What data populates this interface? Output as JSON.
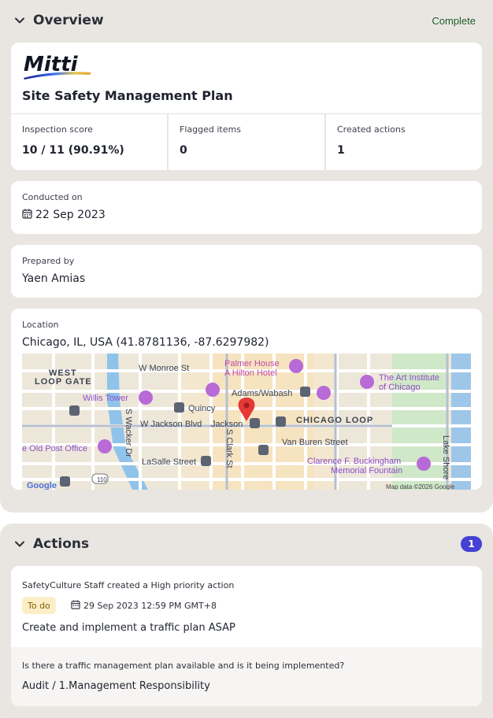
{
  "overview": {
    "title": "Overview",
    "status": "Complete",
    "logo_text": "Mitti",
    "doc_title": "Site Safety Management Plan",
    "stats": [
      {
        "label": "Inspection score",
        "value": "10 / 11 (90.91%)"
      },
      {
        "label": "Flagged items",
        "value": "0"
      },
      {
        "label": "Created actions",
        "value": "1"
      }
    ],
    "conducted": {
      "label": "Conducted on",
      "value": "22 Sep 2023"
    },
    "prepared": {
      "label": "Prepared by",
      "value": "Yaen Amias"
    },
    "location": {
      "label": "Location",
      "value": "Chicago, IL, USA (41.8781136, -87.6297982)",
      "map": {
        "labels": {
          "west_loop_1": "WEST",
          "west_loop_2": "LOOP GATE",
          "monroe": "W Monroe St",
          "palmer_1": "Palmer House",
          "palmer_2": "A Hilton Hotel",
          "art_1": "The Art Institute",
          "art_2": "of Chicago",
          "willis": "Willis Tower",
          "adams": "Adams/Wabash",
          "quincy": "Quincy",
          "wacker": "S Wacker Dr",
          "jackson_blvd": "W Jackson Blvd",
          "jackson": "Jackson",
          "chicago_loop": "CHICAGO LOOP",
          "clark": "S Clark St",
          "van_buren": "Van Buren Street",
          "old_post": "e Old Post Office",
          "lasalle": "LaSalle Street",
          "buckingham_1": "Clarence F. Buckingham",
          "buckingham_2": "Memorial Fountain",
          "lakeshore": "Lake Shore",
          "google": "Google",
          "route": "110",
          "attribution": "Map data ©2026 Google"
        }
      }
    }
  },
  "actions": {
    "title": "Actions",
    "count": "1",
    "item": {
      "meta": "SafetyCulture Staff created a High priority action",
      "status": "To do",
      "due": "29 Sep 2023 12:59 PM GMT+8",
      "title": "Create and implement a traffic plan ASAP",
      "question": "Is there a traffic management plan available and is it being implemented?",
      "breadcrumb": "Audit / 1.Management Responsibility"
    }
  },
  "colors": {
    "accent": "#4740d4",
    "complete": "#1f5d2d",
    "section_bg": "#e9e6e1",
    "todo_bg": "#fcefc8",
    "todo_text": "#8a5a00",
    "map_pin": "#e53935",
    "poi": "#b86ad6"
  },
  "icons": {
    "chevron": "chevron-down-icon",
    "calendar": "calendar-icon",
    "pin": "map-pin-icon",
    "metro": "metro-station-icon"
  }
}
